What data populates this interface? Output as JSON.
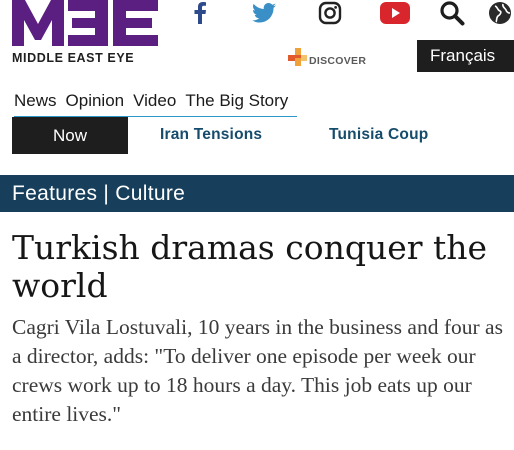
{
  "brand": {
    "logo_mark": "MEE",
    "name": "MIDDLE EAST EYE",
    "accent_color": "#5b1f82"
  },
  "social": [
    "facebook-icon",
    "twitter-icon",
    "instagram-icon",
    "youtube-icon",
    "search-icon",
    "globe-icon"
  ],
  "discover": {
    "label": "DISCOVER",
    "colors": [
      "#f0a23a",
      "#e05a2b"
    ]
  },
  "language_button": {
    "label": "Français"
  },
  "nav": {
    "items": [
      {
        "label": "News"
      },
      {
        "label": "Opinion"
      },
      {
        "label": "Video"
      },
      {
        "label": "The Big Story"
      }
    ]
  },
  "trending": {
    "now_label": "Now",
    "links": [
      {
        "label": "Iran Tensions"
      },
      {
        "label": "Tunisia Coup"
      }
    ]
  },
  "section": {
    "label": "Features | Culture",
    "color": "#173f5c"
  },
  "article": {
    "headline": "Turkish dramas conquer the world",
    "body": "Cagri Vila Lostuvali, 10 years in the business and four as a director, adds: \"To deliver one episode per week our crews work up to 18 hours a day. This job eats up our entire lives.\""
  }
}
